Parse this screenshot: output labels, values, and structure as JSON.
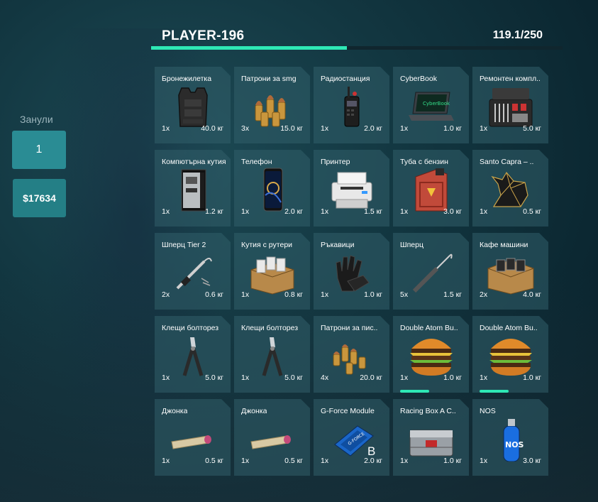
{
  "header": {
    "title": "PLAYER-196",
    "weight": "119.1/250",
    "progress": 0.4764,
    "accent": "#2ee8b5"
  },
  "side": {
    "label": "Занули",
    "count": "1",
    "money": "$17634"
  },
  "slots": [
    {
      "name": "Бронежилетка",
      "qty": "1x",
      "weight": "40.0 кг",
      "icon": "vest-icon"
    },
    {
      "name": "Патрони за smg",
      "qty": "3x",
      "weight": "15.0 кг",
      "icon": "ammo-icon"
    },
    {
      "name": "Радиостанция",
      "qty": "1x",
      "weight": "2.0 кг",
      "icon": "radio-icon"
    },
    {
      "name": "CyberBook",
      "qty": "1x",
      "weight": "1.0 кг",
      "icon": "laptop-icon"
    },
    {
      "name": "Ремонтен компл..",
      "qty": "1x",
      "weight": "5.0 кг",
      "icon": "toolkit-icon"
    },
    {
      "name": "Компютърна кутия",
      "qty": "1x",
      "weight": "1.2 кг",
      "icon": "pc-case-icon"
    },
    {
      "name": "Телефон",
      "qty": "1x",
      "weight": "2.0 кг",
      "icon": "phone-icon"
    },
    {
      "name": "Принтер",
      "qty": "1x",
      "weight": "1.5 кг",
      "icon": "printer-icon"
    },
    {
      "name": "Туба с бензин",
      "qty": "1x",
      "weight": "3.0 кг",
      "icon": "jerrycan-icon"
    },
    {
      "name": "Santo Capra – ..",
      "qty": "1x",
      "weight": "0.5 кг",
      "icon": "goat-statue-icon"
    },
    {
      "name": "Шперц Tier 2",
      "qty": "2x",
      "weight": "0.6 кг",
      "icon": "lockpick-tier2-icon"
    },
    {
      "name": "Кутия с рутери",
      "qty": "1x",
      "weight": "0.8 кг",
      "icon": "router-box-icon"
    },
    {
      "name": "Ръкавици",
      "qty": "1x",
      "weight": "1.0 кг",
      "icon": "gloves-icon"
    },
    {
      "name": "Шперц",
      "qty": "5x",
      "weight": "1.5 кг",
      "icon": "lockpick-icon"
    },
    {
      "name": "Кафе машини",
      "qty": "2x",
      "weight": "4.0 кг",
      "icon": "coffee-box-icon"
    },
    {
      "name": "Клещи болторез",
      "qty": "1x",
      "weight": "5.0 кг",
      "icon": "boltcutter-icon"
    },
    {
      "name": "Клещи болторез",
      "qty": "1x",
      "weight": "5.0 кг",
      "icon": "boltcutter-icon"
    },
    {
      "name": "Патрони за пис..",
      "qty": "4x",
      "weight": "20.0 кг",
      "icon": "pistol-ammo-icon"
    },
    {
      "name": "Double Atom Bu..",
      "qty": "1x",
      "weight": "1.0 кг",
      "icon": "burger-icon",
      "durability": 0.38
    },
    {
      "name": "Double Atom Bu..",
      "qty": "1x",
      "weight": "1.0 кг",
      "icon": "burger-icon",
      "durability": 0.38
    },
    {
      "name": "Джонка",
      "qty": "1x",
      "weight": "0.5 кг",
      "icon": "joint-icon"
    },
    {
      "name": "Джонка",
      "qty": "1x",
      "weight": "0.5 кг",
      "icon": "joint-icon"
    },
    {
      "name": "G-Force Module",
      "qty": "1x",
      "weight": "2.0 кг",
      "icon": "gforce-module-icon",
      "badge": "B"
    },
    {
      "name": "Racing Box A C..",
      "qty": "1x",
      "weight": "1.0 кг",
      "icon": "racing-box-icon"
    },
    {
      "name": "NOS",
      "qty": "1x",
      "weight": "3.0 кг",
      "icon": "nos-bottle-icon"
    }
  ]
}
